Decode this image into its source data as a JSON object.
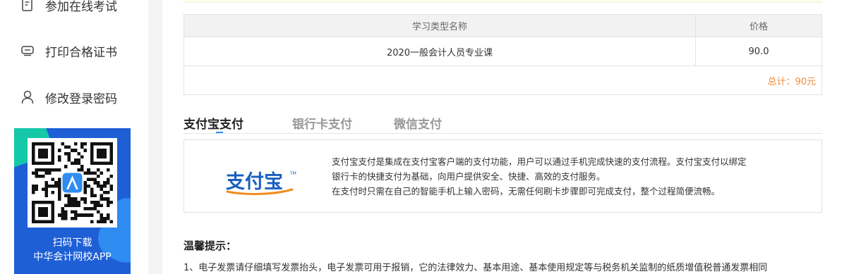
{
  "sidebar": {
    "items": [
      {
        "label": "参加在线考试",
        "icon": "exam-icon"
      },
      {
        "label": "打印合格证书",
        "icon": "certificate-icon"
      },
      {
        "label": "修改登录密码",
        "icon": "user-icon"
      }
    ],
    "app_promo": {
      "line1": "扫码下载",
      "line2": "中华会计网校APP"
    }
  },
  "order_table": {
    "headers": [
      "学习类型名称",
      "价格"
    ],
    "rows": [
      {
        "name": "2020一般会计人员专业课",
        "price": "90.0"
      }
    ],
    "total": "总计：90元"
  },
  "payment_tabs": [
    {
      "label": "支付宝支付",
      "active": true
    },
    {
      "label": "银行卡支付",
      "active": false
    },
    {
      "label": "微信支付",
      "active": false
    }
  ],
  "alipay": {
    "logo_text": "支付宝",
    "description": [
      "支付宝支付是集成在支付宝客户端的支付功能，用户可以通过手机完成快速的支付流程。支付宝支付以绑定",
      "银行卡的快捷支付为基础，向用户提供安全、快捷、高效的支付服务。",
      "在支付时只需在自己的智能手机上输入密码，无需任何刷卡步骤即可完成支付，整个过程简便流畅。"
    ]
  },
  "tips": {
    "title": "温馨提示：",
    "line1": "1、电子发票请仔细填写发票抬头，电子发票可用于报销，它的法律效力、基本用途、基本使用规定等与税务机关监制的纸质增值税普通发票相同"
  },
  "colors": {
    "accent": "#2f8cf0",
    "total": "#f08c3c",
    "promo_bg": "#1f5fd6",
    "alipay_blue": "#1a5fc0",
    "alipay_orange": "#f08c1e"
  }
}
